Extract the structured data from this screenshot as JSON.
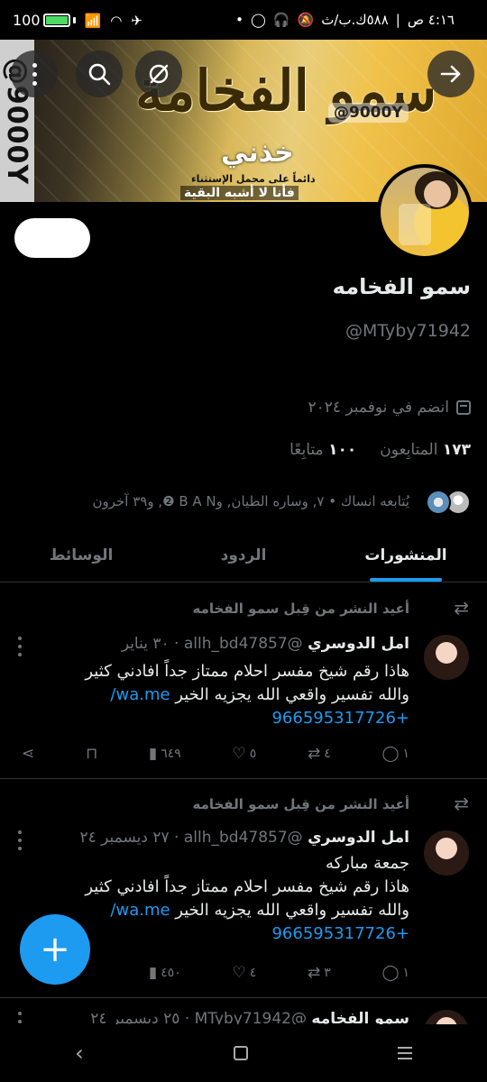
{
  "status_bar": {
    "time": "٤:١٦ ص",
    "data_speed": "٥٨٨ك.ب/ث",
    "battery_percent": "100",
    "battery_level": 1.0,
    "icons": [
      "bolt-icon",
      "wifi-signal-icon",
      "wifi-icon",
      "airplane-icon",
      "whatsapp-icon",
      "headset-icon",
      "mute-icon",
      "dot-icon"
    ]
  },
  "banner": {
    "vertical_text": "@9000Y",
    "title": "سمو الفخامة",
    "handle": "@9000Y",
    "line1": "خذني",
    "line2": "دائماً على محمل الإستثناء",
    "line3": "فأنا لا أشبه البقية"
  },
  "profile": {
    "name": "سمو الفخامه",
    "handle": "@MTyby71942",
    "joined": "انضم في نوفمبر ٢٠٢٤",
    "following_count": "١٠٠",
    "following_label": "متابِعًا",
    "followers_count": "١٧٣",
    "followers_label": "المتابِعون",
    "followed_by": "يُتابعه انساك • ٧, وساره الطيان, وB A N ❷, و٣٩ آخرون"
  },
  "tabs": [
    {
      "label": "المنشورات",
      "active": true
    },
    {
      "label": "الردود",
      "active": false
    },
    {
      "label": "الوسائط",
      "active": false
    }
  ],
  "posts": [
    {
      "repost_label": "أعيد النشر من قِبل سمو الفخامه",
      "author": "امل الدوسري",
      "meta": "@allh_bd47857 · ٣٠ يناير",
      "text": "هاذا رقم شيخ مفسر احلام ممتاز جداً  افادني كثير والله تفسير واقعي الله  يجزيه الخير",
      "link1": "wa.me/",
      "link2": "+966595317726",
      "replies": "١",
      "reposts": "٤",
      "likes": "٥",
      "views": "٦٤٩"
    },
    {
      "repost_label": "أعيد النشر من قِبل سمو الفخامه",
      "author": "امل الدوسري",
      "meta": "@allh_bd47857 · ٢٧ ديسمبر ٢٤",
      "pre_text": "جمعة مباركه",
      "text": "هاذا رقم شيخ مفسر احلام ممتاز جداً  افادني كثير والله تفسير واقعي الله  يجزيه الخير",
      "link1": "wa.me/",
      "link2": "+966595317726",
      "replies": "١",
      "reposts": "٣",
      "likes": "٤",
      "views": "٤٥٠"
    },
    {
      "author": "سمو الفخامه",
      "meta": "@MTyby71942 · ٢٥ ديسمبر ٢٤"
    }
  ],
  "colors": {
    "accent": "#1d9bf0",
    "background": "#000000",
    "text_primary": "#e7e9ea",
    "text_secondary": "#71767b"
  }
}
